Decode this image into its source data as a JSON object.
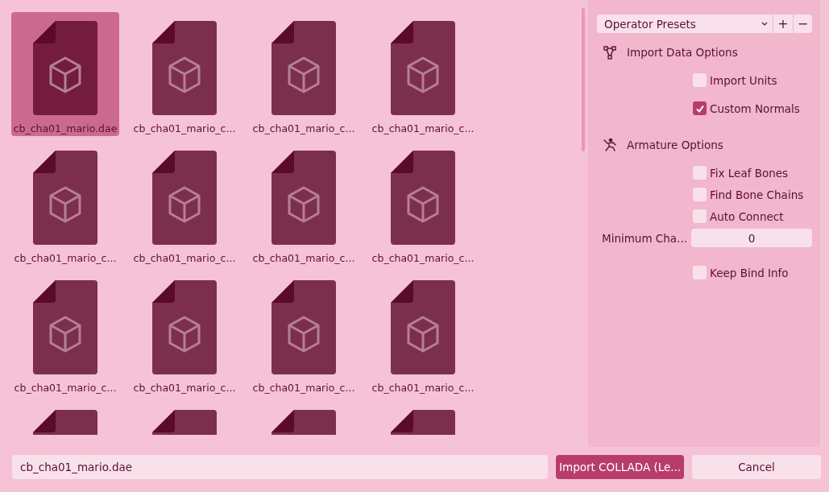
{
  "files": [
    {
      "name": "cb_cha01_mario.dae",
      "selected": true
    },
    {
      "name": "cb_cha01_mario_c...",
      "selected": false
    },
    {
      "name": "cb_cha01_mario_c...",
      "selected": false
    },
    {
      "name": "cb_cha01_mario_c...",
      "selected": false
    },
    {
      "name": "cb_cha01_mario_c...",
      "selected": false
    },
    {
      "name": "cb_cha01_mario_c...",
      "selected": false
    },
    {
      "name": "cb_cha01_mario_c...",
      "selected": false
    },
    {
      "name": "cb_cha01_mario_c...",
      "selected": false
    },
    {
      "name": "cb_cha01_mario_c...",
      "selected": false
    },
    {
      "name": "cb_cha01_mario_c...",
      "selected": false
    },
    {
      "name": "cb_cha01_mario_c...",
      "selected": false
    },
    {
      "name": "cb_cha01_mario_c...",
      "selected": false
    },
    {
      "selected": false
    },
    {
      "selected": false
    },
    {
      "selected": false
    },
    {
      "selected": false
    }
  ],
  "presets": {
    "label": "Operator Presets",
    "add": "+",
    "remove": "−"
  },
  "options": [
    {
      "kind": "header",
      "label": "Import Data Options"
    },
    {
      "kind": "checkbox",
      "label": "Import Units",
      "checked": false
    },
    {
      "kind": "gap"
    },
    {
      "kind": "checkbox",
      "label": "Custom Normals",
      "checked": true
    },
    {
      "kind": "gap"
    },
    {
      "kind": "header",
      "label": "Armature Options"
    },
    {
      "kind": "checkbox",
      "label": "Fix Leaf Bones",
      "checked": false
    },
    {
      "kind": "checkbox",
      "label": "Find Bone Chains",
      "checked": false
    },
    {
      "kind": "checkbox",
      "label": "Auto Connect",
      "checked": false
    },
    {
      "kind": "number",
      "label": "Minimum Cha...",
      "value": "0"
    },
    {
      "kind": "gap"
    },
    {
      "kind": "checkbox",
      "label": "Keep Bind Info",
      "checked": false
    }
  ],
  "filename": {
    "value": "cb_cha01_mario.dae"
  },
  "buttons": [
    {
      "label": "Import COLLADA (Le...",
      "kind": "primary"
    },
    {
      "label": "Cancel",
      "kind": "secondary"
    }
  ]
}
